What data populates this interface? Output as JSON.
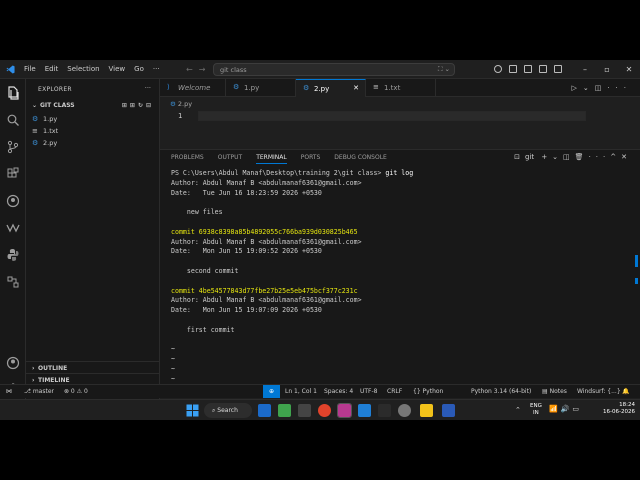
{
  "titlebar": {
    "menu": [
      "File",
      "Edit",
      "Selection",
      "View",
      "Go",
      "···"
    ],
    "search": "git class"
  },
  "sidebar": {
    "title": "EXPLORER",
    "folder": "GIT CLASS",
    "files": [
      {
        "name": "1.py",
        "icon": "python-icon"
      },
      {
        "name": "1.txt",
        "icon": "text-file-icon"
      },
      {
        "name": "2.py",
        "icon": "python-icon"
      }
    ],
    "outline": "OUTLINE",
    "timeline": "TIMELINE"
  },
  "tabs": [
    {
      "label": "Welcome",
      "icon": "vscode-icon"
    },
    {
      "label": "1.py",
      "icon": "python-icon"
    },
    {
      "label": "2.py",
      "icon": "python-icon",
      "active": true
    },
    {
      "label": "1.txt",
      "icon": "text-file-icon"
    }
  ],
  "editor": {
    "breadcrumb": "2.py",
    "line_number": "1"
  },
  "panel": {
    "tabs": [
      "PROBLEMS",
      "OUTPUT",
      "TERMINAL",
      "PORTS",
      "DEBUG CONSOLE"
    ],
    "active_tab": "TERMINAL",
    "shell": "git",
    "terminal_lines": [
      {
        "text": "PS C:\\Users\\Abdul Manaf\\Desktop\\training 2\\git class> ",
        "cmd": "git log",
        "style": "prompt"
      },
      {
        "text": "Author: Abdul Manaf B <abdulmanaf6361@gmail.com>",
        "style": "normal"
      },
      {
        "text": "Date:   Tue Jun 16 18:23:59 2026 +0530",
        "style": "normal"
      },
      {
        "text": "",
        "style": "normal"
      },
      {
        "text": "    new files",
        "style": "normal"
      },
      {
        "text": "",
        "style": "normal"
      },
      {
        "text": "commit 6938c8398a85b4892055c766ba939d030825b465",
        "style": "yellow"
      },
      {
        "text": "Author: Abdul Manaf B <abdulmanaf6361@gmail.com>",
        "style": "normal"
      },
      {
        "text": "Date:   Mon Jun 15 19:09:52 2026 +0530",
        "style": "normal"
      },
      {
        "text": "",
        "style": "normal"
      },
      {
        "text": "    second commit",
        "style": "normal"
      },
      {
        "text": "",
        "style": "normal"
      },
      {
        "text": "commit 4be54577843d77fbe27b25e5eb475bcf377c231c",
        "style": "yellow"
      },
      {
        "text": "Author: Abdul Manaf B <abdulmanaf6361@gmail.com>",
        "style": "normal"
      },
      {
        "text": "Date:   Mon Jun 15 19:07:09 2026 +0530",
        "style": "normal"
      },
      {
        "text": "",
        "style": "normal"
      },
      {
        "text": "    first commit",
        "style": "normal"
      },
      {
        "text": "",
        "style": "normal"
      },
      {
        "text": "~",
        "style": "normal"
      },
      {
        "text": "~",
        "style": "normal"
      },
      {
        "text": "~",
        "style": "normal"
      },
      {
        "text": "~",
        "style": "normal"
      }
    ]
  },
  "statusbar": {
    "branch": "master",
    "problems": "⊗ 0 ⚠ 0",
    "position": "Ln 1, Col 1",
    "spaces": "Spaces: 4",
    "encoding": "UTF-8",
    "eol": "CRLF",
    "language": "Python",
    "interpreter": "Python 3.14 (64-bit)",
    "notes": "Notes",
    "windsurf": "Windsurf: {...}"
  },
  "taskbar": {
    "search": "Search",
    "lang_top": "ENG",
    "lang_bottom": "IN",
    "time": "18:24",
    "date": "16-06-2026"
  },
  "colors": {
    "accent": "#0078d4",
    "commit_hash": "#e5e510",
    "background": "#1f1f1f"
  }
}
